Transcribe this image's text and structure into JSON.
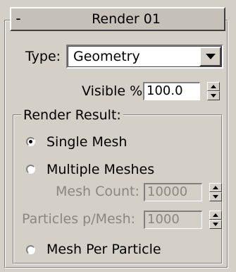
{
  "rollout": {
    "collapse_symbol": "-",
    "title": "Render 01"
  },
  "type": {
    "label": "Type:",
    "value": "Geometry"
  },
  "visible": {
    "label": "Visible %",
    "value": "100.0"
  },
  "render_result": {
    "title": "Render Result:",
    "options": [
      {
        "label": "Single Mesh",
        "selected": true
      },
      {
        "label": "Multiple Meshes",
        "selected": false
      },
      {
        "label": "Mesh Per Particle",
        "selected": false
      }
    ],
    "mesh_count": {
      "label": "Mesh Count:",
      "value": "10000",
      "enabled": false
    },
    "particles_per_mesh": {
      "label": "Particles p/Mesh:",
      "value": "1000",
      "enabled": false
    }
  },
  "colors": {
    "panel": "#d4d0c8",
    "disabled_text": "#8a8781"
  },
  "icons": [
    "collapse-minus-icon",
    "dropdown-arrow-icon",
    "spinner-up-icon",
    "spinner-down-icon",
    "radio-icon"
  ]
}
